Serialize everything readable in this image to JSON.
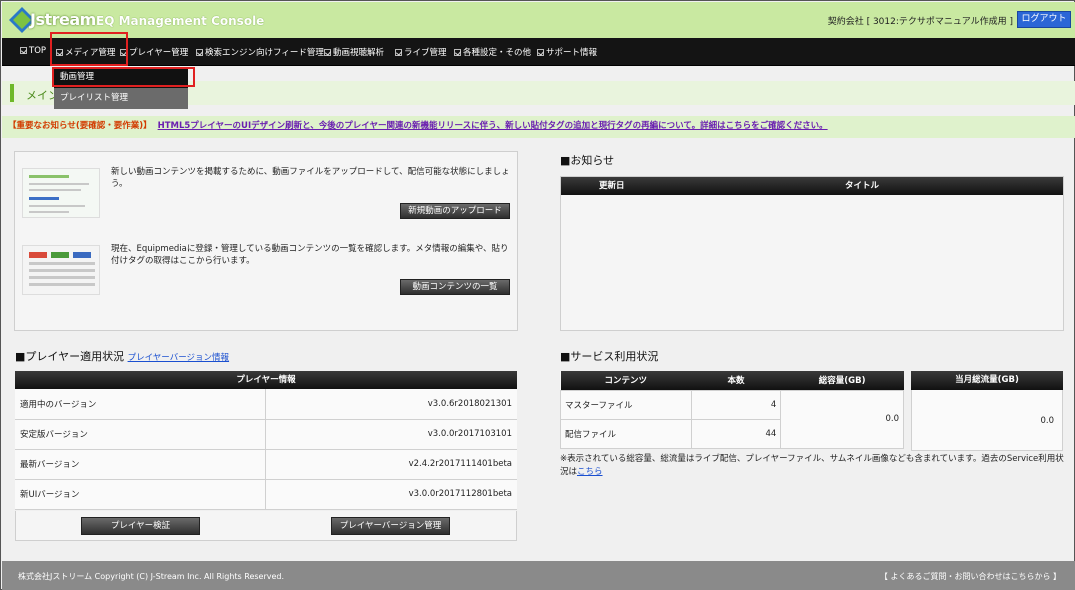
{
  "header": {
    "logo_text": "Jstream",
    "app_title": "EQ Management Console",
    "contract": "契約会社 [ 3012:テクサポマニュアル作成用 ]",
    "logout_label": "ログアウト"
  },
  "nav": {
    "items": [
      {
        "label": "TOP"
      },
      {
        "label": "メディア管理"
      },
      {
        "label": "プレイヤー管理"
      },
      {
        "label": "検索エンジン向けフィード管理"
      },
      {
        "label": "動画視聴解析"
      },
      {
        "label": "ライブ管理"
      },
      {
        "label": "各種設定・その他"
      },
      {
        "label": "サポート情報"
      }
    ],
    "dropdown": [
      "動画管理",
      "プレイリスト管理"
    ]
  },
  "page_title": "メイン",
  "notice": {
    "label": "【重要なお知らせ(要確認・要作業)】",
    "link": "HTML5プレイヤーのUIデザイン刷新と、今後のプレイヤー関連の新機能リリースに伴う、新しい貼付タグの追加と現行タグの再編について。詳細はこちらをご確認ください。"
  },
  "media": {
    "upload_desc": "新しい動画コンテンツを掲載するために、動画ファイルをアップロードして、配信可能な状態にしましょう。",
    "upload_button": "新規動画のアップロード",
    "list_desc": "現在、Equipmediaに登録・管理している動画コンテンツの一覧を確認します。メタ情報の編集や、貼り付けタグの取得はここから行います。",
    "list_button": "動画コンテンツの一覧"
  },
  "news": {
    "title": "■お知らせ",
    "col_date": "更新日",
    "col_title": "タイトル"
  },
  "player": {
    "title": "■プレイヤー適用状況",
    "version_link": "プレイヤーバージョン情報",
    "table_head": "プレイヤー情報",
    "rows": [
      {
        "label": "適用中のバージョン",
        "value": "v3.0.6r2018021301"
      },
      {
        "label": "安定版バージョン",
        "value": "v3.0.0r2017103101"
      },
      {
        "label": "最新バージョン",
        "value": "v2.4.2r2017111401beta"
      },
      {
        "label": "新UIバージョン",
        "value": "v3.0.0r2017112801beta"
      }
    ],
    "verify_button": "プレイヤー検証",
    "manage_button": "プレイヤーバージョン管理"
  },
  "service": {
    "title": "■サービス利用状況",
    "col_content": "コンテンツ",
    "col_count": "本数",
    "col_capacity": "総容量(GB)",
    "col_monthly": "当月総流量(GB)",
    "rows": [
      {
        "label": "マスターファイル",
        "count": "4"
      },
      {
        "label": "配信ファイル",
        "count": "44"
      }
    ],
    "capacity": "0.0",
    "monthly": "0.0",
    "footnote": "※表示されている総容量、総流量はライブ配信、プレイヤーファイル、サムネイル画像なども含まれています。過去のService利用状況は",
    "footnote_link": "こちら"
  },
  "footer": {
    "copyright": "株式会社Jストリーム Copyright (C) J-Stream Inc. All Rights Reserved.",
    "faq": "【 よくあるご質問・お問い合わせはこちらから 】"
  },
  "colors": {
    "header_green": "#c9e9a1",
    "accent_green": "#6fb82a",
    "logout_blue": "#2b66d6",
    "notice_red": "#d23b00",
    "link_purple": "#6a1fb0",
    "highlight_red": "#e02020"
  }
}
